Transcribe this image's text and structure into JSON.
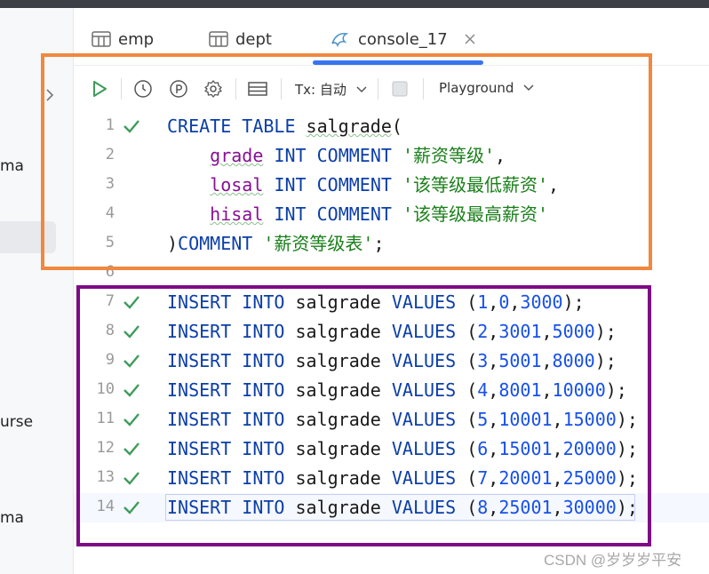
{
  "sidebar": {
    "items": [
      {
        "label": "ma"
      },
      {
        "label": "urse"
      },
      {
        "label": "ma"
      }
    ]
  },
  "tabs": [
    {
      "label": "emp",
      "icon": "table-icon"
    },
    {
      "label": "dept",
      "icon": "table-icon"
    },
    {
      "label": "console_17",
      "icon": "console-icon",
      "active": true
    }
  ],
  "toolbar": {
    "tx_label": "Tx: 自动",
    "playground_label": "Playground"
  },
  "editor": {
    "lines": [
      {
        "n": "1",
        "check": true,
        "tokens": [
          [
            "kw",
            "CREATE "
          ],
          [
            "kw",
            "TABLE "
          ],
          [
            "id w",
            "salgrade"
          ],
          [
            "id",
            "("
          ]
        ]
      },
      {
        "n": "2",
        "check": false,
        "tokens": [
          [
            "id",
            "    "
          ],
          [
            "fld w",
            "grade"
          ],
          [
            "id",
            " "
          ],
          [
            "kw",
            "INT "
          ],
          [
            "kw",
            "COMMENT "
          ],
          [
            "str",
            "'薪资等级'"
          ],
          [
            "id",
            ","
          ]
        ]
      },
      {
        "n": "3",
        "check": false,
        "tokens": [
          [
            "id",
            "    "
          ],
          [
            "fld w",
            "losal"
          ],
          [
            "id",
            " "
          ],
          [
            "kw",
            "INT "
          ],
          [
            "kw",
            "COMMENT "
          ],
          [
            "str",
            "'该等级最低薪资'"
          ],
          [
            "id",
            ","
          ]
        ]
      },
      {
        "n": "4",
        "check": false,
        "tokens": [
          [
            "id",
            "    "
          ],
          [
            "fld w",
            "hisal"
          ],
          [
            "id",
            " "
          ],
          [
            "kw",
            "INT "
          ],
          [
            "kw",
            "COMMENT "
          ],
          [
            "str",
            "'该等级最高薪资'"
          ]
        ]
      },
      {
        "n": "5",
        "check": false,
        "tokens": [
          [
            "id",
            ")"
          ],
          [
            "kw",
            "COMMENT "
          ],
          [
            "str",
            "'薪资等级表'"
          ],
          [
            "id",
            ";"
          ]
        ]
      },
      {
        "n": "6",
        "check": false,
        "tokens": []
      },
      {
        "n": "7",
        "check": true,
        "tokens": [
          [
            "kw",
            "INSERT "
          ],
          [
            "kw",
            "INTO "
          ],
          [
            "id",
            "salgrade "
          ],
          [
            "kw",
            "VALUES "
          ],
          [
            "id",
            "("
          ],
          [
            "num",
            "1"
          ],
          [
            "id",
            ","
          ],
          [
            "num",
            "0"
          ],
          [
            "id",
            ","
          ],
          [
            "num",
            "3000"
          ],
          [
            "id",
            ");"
          ]
        ]
      },
      {
        "n": "8",
        "check": true,
        "tokens": [
          [
            "kw",
            "INSERT "
          ],
          [
            "kw",
            "INTO "
          ],
          [
            "id",
            "salgrade "
          ],
          [
            "kw",
            "VALUES "
          ],
          [
            "id",
            "("
          ],
          [
            "num",
            "2"
          ],
          [
            "id",
            ","
          ],
          [
            "num",
            "3001"
          ],
          [
            "id",
            ","
          ],
          [
            "num",
            "5000"
          ],
          [
            "id",
            ");"
          ]
        ]
      },
      {
        "n": "9",
        "check": true,
        "tokens": [
          [
            "kw",
            "INSERT "
          ],
          [
            "kw",
            "INTO "
          ],
          [
            "id",
            "salgrade "
          ],
          [
            "kw",
            "VALUES "
          ],
          [
            "id",
            "("
          ],
          [
            "num",
            "3"
          ],
          [
            "id",
            ","
          ],
          [
            "num",
            "5001"
          ],
          [
            "id",
            ","
          ],
          [
            "num",
            "8000"
          ],
          [
            "id",
            ");"
          ]
        ]
      },
      {
        "n": "10",
        "check": true,
        "tokens": [
          [
            "kw",
            "INSERT "
          ],
          [
            "kw",
            "INTO "
          ],
          [
            "id",
            "salgrade "
          ],
          [
            "kw",
            "VALUES "
          ],
          [
            "id",
            "("
          ],
          [
            "num",
            "4"
          ],
          [
            "id",
            ","
          ],
          [
            "num",
            "8001"
          ],
          [
            "id",
            ","
          ],
          [
            "num",
            "10000"
          ],
          [
            "id",
            ");"
          ]
        ]
      },
      {
        "n": "11",
        "check": true,
        "tokens": [
          [
            "kw",
            "INSERT "
          ],
          [
            "kw",
            "INTO "
          ],
          [
            "id",
            "salgrade "
          ],
          [
            "kw",
            "VALUES "
          ],
          [
            "id",
            "("
          ],
          [
            "num",
            "5"
          ],
          [
            "id",
            ","
          ],
          [
            "num",
            "10001"
          ],
          [
            "id",
            ","
          ],
          [
            "num",
            "15000"
          ],
          [
            "id",
            ");"
          ]
        ]
      },
      {
        "n": "12",
        "check": true,
        "tokens": [
          [
            "kw",
            "INSERT "
          ],
          [
            "kw",
            "INTO "
          ],
          [
            "id",
            "salgrade "
          ],
          [
            "kw",
            "VALUES "
          ],
          [
            "id",
            "("
          ],
          [
            "num",
            "6"
          ],
          [
            "id",
            ","
          ],
          [
            "num",
            "15001"
          ],
          [
            "id",
            ","
          ],
          [
            "num",
            "20000"
          ],
          [
            "id",
            ");"
          ]
        ]
      },
      {
        "n": "13",
        "check": true,
        "tokens": [
          [
            "kw",
            "INSERT "
          ],
          [
            "kw",
            "INTO "
          ],
          [
            "id",
            "salgrade "
          ],
          [
            "kw",
            "VALUES "
          ],
          [
            "id",
            "("
          ],
          [
            "num",
            "7"
          ],
          [
            "id",
            ","
          ],
          [
            "num",
            "20001"
          ],
          [
            "id",
            ","
          ],
          [
            "num",
            "25000"
          ],
          [
            "id",
            ");"
          ]
        ]
      },
      {
        "n": "14",
        "check": true,
        "current": true,
        "tokens": [
          [
            "kw",
            "INSERT "
          ],
          [
            "kw",
            "INTO "
          ],
          [
            "id",
            "salgrade "
          ],
          [
            "kw",
            "VALUES "
          ],
          [
            "id",
            "("
          ],
          [
            "num",
            "8"
          ],
          [
            "id",
            ","
          ],
          [
            "num",
            "25001"
          ],
          [
            "id",
            ","
          ],
          [
            "num",
            "30000"
          ],
          [
            "id",
            ");"
          ]
        ]
      }
    ]
  },
  "watermark": "CSDN @岁岁岁平安",
  "colors": {
    "orange_box": "#f0883e",
    "purple_box": "#7e0a86",
    "keyword": "#0b3ea8",
    "string": "#1a7f1a",
    "number": "#1750eb",
    "field": "#871094",
    "check": "#3d9c5a",
    "accent": "#3874f0"
  }
}
